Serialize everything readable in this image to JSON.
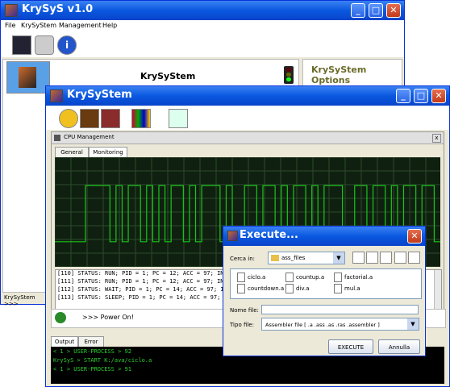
{
  "main_window": {
    "title": "KrySyS v1.0",
    "menu": [
      "File",
      "KrySyStem",
      "Management",
      "Help"
    ],
    "panel_title": "KrySyStem",
    "options_title": "KrySyStem Options",
    "status_left": "KrySyStem >>>"
  },
  "krysystem_window": {
    "title": "KrySyStem",
    "internal_frame_title": "CPU Management",
    "tabs": [
      "General",
      "Monitoring"
    ],
    "active_tab": "Monitoring",
    "log_lines": [
      "[110]      STATUS: RUN; PID = 1; PC = 12; ACC = 97; IN",
      "[111]      STATUS: RUN; PID = 1; PC = 12; ACC = 97; IN",
      "[112]      STATUS: WAIT; PID = 1; PC = 14; ACC = 97; IN",
      "[113]      STATUS: SLEEP; PID = 1; PC = 14; ACC = 97; IN"
    ],
    "power_message": ">>> Power On!",
    "bottom_tabs": [
      "Output",
      "Error"
    ],
    "output_lines": [
      "< 1 > USER-PROCESS > 92",
      "KrySyS > START K:/ava/ciclo.a",
      "< 1 > USER-PROCESS > 91"
    ],
    "colors": {
      "graph_line": "#19c619",
      "graph_bg": "#102010",
      "console_text": "#2fcf2f"
    }
  },
  "execute_dialog": {
    "title": "Execute...",
    "look_in_label": "Cerca in:",
    "look_in_value": "ass_files",
    "files": [
      "ciclo.a",
      "countup.a",
      "factorial.a",
      "countdown.a",
      "div.a",
      "mul.a"
    ],
    "filename_label": "Nome file:",
    "filename_value": "",
    "filetype_label": "Tipo file:",
    "filetype_value": "Assembler file [ .a .ass .as .ras .assembler ]",
    "execute_button": "EXECUTE",
    "cancel_button": "Annulla"
  },
  "graph_values": [
    2,
    2,
    2,
    2,
    2,
    8,
    8,
    8,
    8,
    2,
    8,
    2,
    8,
    8,
    2,
    8,
    2,
    8,
    2,
    8,
    8,
    2,
    8,
    2,
    8,
    8,
    8,
    2,
    8,
    2,
    2,
    8,
    8,
    2,
    8,
    8,
    2,
    8,
    2,
    8,
    8,
    2,
    8,
    2,
    8,
    8,
    8,
    2,
    2,
    8,
    8,
    2,
    8,
    8,
    2,
    8,
    2,
    8,
    8,
    2,
    8,
    8,
    2
  ]
}
